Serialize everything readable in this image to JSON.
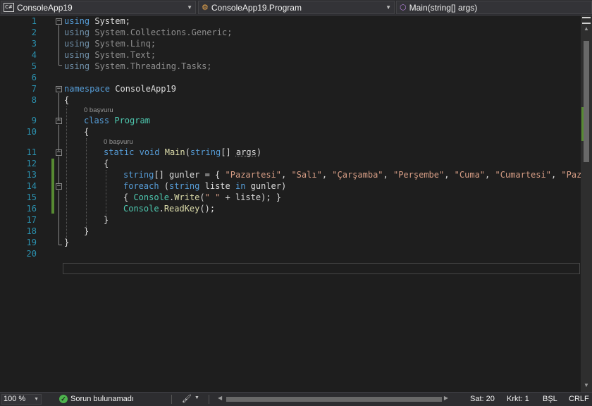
{
  "nav": {
    "project": "ConsoleApp19",
    "type": "ConsoleApp19.Program",
    "member": "Main(string[] args)",
    "project_icon_text": "C#",
    "project_icon": "csharp-project-icon",
    "type_icon": "class-icon",
    "member_icon": "method-icon"
  },
  "editor": {
    "line_numbers": [
      "1",
      "2",
      "3",
      "4",
      "5",
      "6",
      "7",
      "8",
      "9",
      "10",
      "11",
      "12",
      "13",
      "14",
      "15",
      "16",
      "17",
      "18",
      "19",
      "20"
    ],
    "references_label": "0 başvuru",
    "code": {
      "using_kw": "using",
      "system": " System;",
      "generic": " System.Collections.Generic;",
      "linq": " System.Linq;",
      "text": " System.Text;",
      "tasks": " System.Threading.Tasks;",
      "namespace_kw": "namespace",
      "namespace_name": " ConsoleApp19",
      "open_brace": "{",
      "close_brace": "}",
      "class_kw": "class",
      "class_name": "Program",
      "static_kw": "static",
      "void_kw": "void",
      "main_name": "Main",
      "paren_open": "(",
      "string_kw": "string",
      "array_brackets": "[] ",
      "args": "args",
      "paren_close": ")",
      "gunler_decl": "[] gunler = { ",
      "days": [
        "\"Pazartesi\"",
        "\"Salı\"",
        "\"Çarşamba\"",
        "\"Perşembe\"",
        "\"Cuma\"",
        "\"Cumartesi\"",
        "\"Pazar\""
      ],
      "comma": ", ",
      "foreach_kw": "foreach",
      "foreach_open": " (",
      "foreach_var": " liste ",
      "in_kw": "in",
      "foreach_rest": " gunler)",
      "write_open": "{ ",
      "console": "Console",
      "dot": ".",
      "write": "Write",
      "write_paren": "(",
      "space_str": "\" \"",
      "write_rest": " + liste); }",
      "readkey": "ReadKey",
      "readkey_rest": "();"
    }
  },
  "status": {
    "zoom": "100 %",
    "issues": "Sorun bulunamadı",
    "line": "Sat: 20",
    "column": "Krkt: 1",
    "mode": "BŞL",
    "line_ending": "CRLF"
  },
  "colors": {
    "keyword": "#569cd6",
    "type": "#4ec9b0",
    "string": "#d69d85",
    "method": "#dcdcaa",
    "line_number": "#2b91af",
    "change_marker": "#578a32"
  }
}
